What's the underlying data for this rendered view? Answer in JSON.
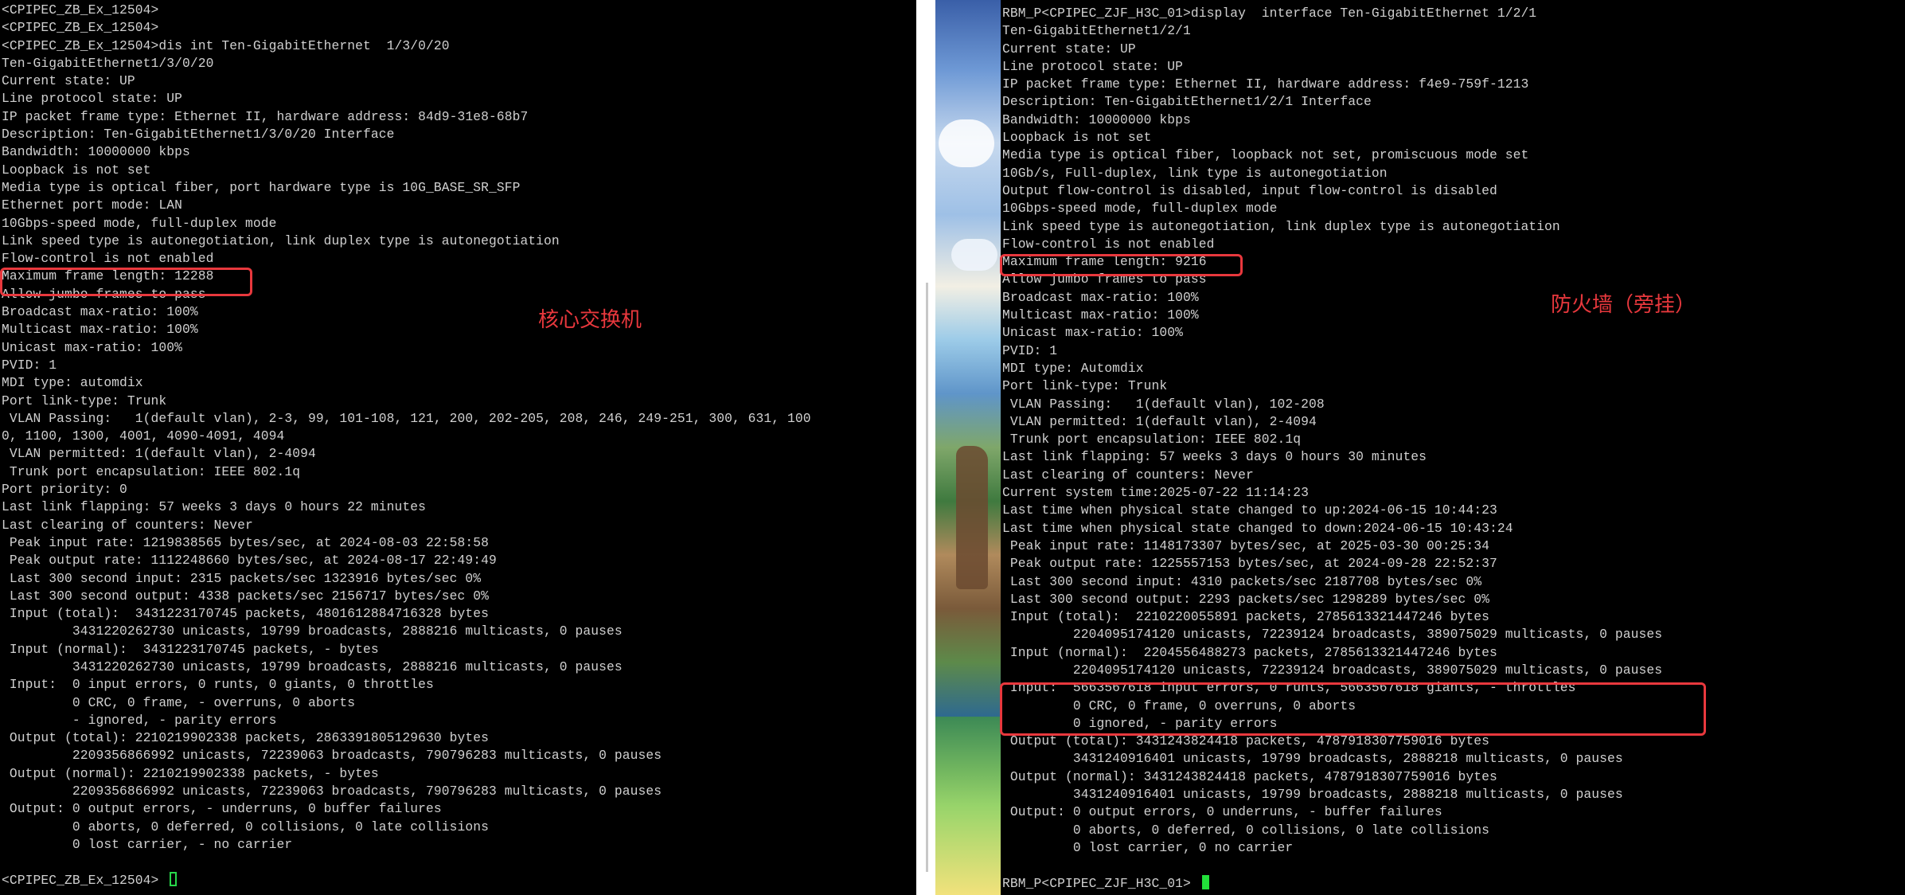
{
  "left_terminal": {
    "lines": [
      "<CPIPEC_ZB_Ex_12504>",
      "<CPIPEC_ZB_Ex_12504>",
      "<CPIPEC_ZB_Ex_12504>dis int Ten-GigabitEthernet  1/3/0/20",
      "Ten-GigabitEthernet1/3/0/20",
      "Current state: UP",
      "Line protocol state: UP",
      "IP packet frame type: Ethernet II, hardware address: 84d9-31e8-68b7",
      "Description: Ten-GigabitEthernet1/3/0/20 Interface",
      "Bandwidth: 10000000 kbps",
      "Loopback is not set",
      "Media type is optical fiber, port hardware type is 10G_BASE_SR_SFP",
      "Ethernet port mode: LAN",
      "10Gbps-speed mode, full-duplex mode",
      "Link speed type is autonegotiation, link duplex type is autonegotiation",
      "Flow-control is not enabled",
      "Maximum frame length: 12288",
      "Allow jumbo frames to pass",
      "Broadcast max-ratio: 100%",
      "Multicast max-ratio: 100%",
      "Unicast max-ratio: 100%",
      "PVID: 1",
      "MDI type: automdix",
      "Port link-type: Trunk",
      " VLAN Passing:   1(default vlan), 2-3, 99, 101-108, 121, 200, 202-205, 208, 246, 249-251, 300, 631, 100",
      "0, 1100, 1300, 4001, 4090-4091, 4094",
      " VLAN permitted: 1(default vlan), 2-4094",
      " Trunk port encapsulation: IEEE 802.1q",
      "Port priority: 0",
      "Last link flapping: 57 weeks 3 days 0 hours 22 minutes",
      "Last clearing of counters: Never",
      " Peak input rate: 1219838565 bytes/sec, at 2024-08-03 22:58:58",
      " Peak output rate: 1112248660 bytes/sec, at 2024-08-17 22:49:49",
      " Last 300 second input: 2315 packets/sec 1323916 bytes/sec 0%",
      " Last 300 second output: 4338 packets/sec 2156717 bytes/sec 0%",
      " Input (total):  3431223170745 packets, 4801612884716328 bytes",
      "         3431220262730 unicasts, 19799 broadcasts, 2888216 multicasts, 0 pauses",
      " Input (normal):  3431223170745 packets, - bytes",
      "         3431220262730 unicasts, 19799 broadcasts, 2888216 multicasts, 0 pauses",
      " Input:  0 input errors, 0 runts, 0 giants, 0 throttles",
      "         0 CRC, 0 frame, - overruns, 0 aborts",
      "         - ignored, - parity errors",
      " Output (total): 2210219902338 packets, 2863391805129630 bytes",
      "         2209356866992 unicasts, 72239063 broadcasts, 790796283 multicasts, 0 pauses",
      " Output (normal): 2210219902338 packets, - bytes",
      "         2209356866992 unicasts, 72239063 broadcasts, 790796283 multicasts, 0 pauses",
      " Output: 0 output errors, - underruns, 0 buffer failures",
      "         0 aborts, 0 deferred, 0 collisions, 0 late collisions",
      "         0 lost carrier, - no carrier",
      "",
      "<CPIPEC_ZB_Ex_12504> "
    ],
    "annotation_label": "核心交换机"
  },
  "right_terminal": {
    "lines": [
      "RBM_P<CPIPEC_ZJF_H3C_01>display  interface Ten-GigabitEthernet 1/2/1",
      "Ten-GigabitEthernet1/2/1",
      "Current state: UP",
      "Line protocol state: UP",
      "IP packet frame type: Ethernet II, hardware address: f4e9-759f-1213",
      "Description: Ten-GigabitEthernet1/2/1 Interface",
      "Bandwidth: 10000000 kbps",
      "Loopback is not set",
      "Media type is optical fiber, loopback not set, promiscuous mode set",
      "10Gb/s, Full-duplex, link type is autonegotiation",
      "Output flow-control is disabled, input flow-control is disabled",
      "10Gbps-speed mode, full-duplex mode",
      "Link speed type is autonegotiation, link duplex type is autonegotiation",
      "Flow-control is not enabled",
      "Maximum frame length: 9216",
      "Allow jumbo frames to pass",
      "Broadcast max-ratio: 100%",
      "Multicast max-ratio: 100%",
      "Unicast max-ratio: 100%",
      "PVID: 1",
      "MDI type: Automdix",
      "Port link-type: Trunk",
      " VLAN Passing:   1(default vlan), 102-208",
      " VLAN permitted: 1(default vlan), 2-4094",
      " Trunk port encapsulation: IEEE 802.1q",
      "Last link flapping: 57 weeks 3 days 0 hours 30 minutes",
      "Last clearing of counters: Never",
      "Current system time:2025-07-22 11:14:23",
      "Last time when physical state changed to up:2024-06-15 10:44:23",
      "Last time when physical state changed to down:2024-06-15 10:43:24",
      " Peak input rate: 1148173307 bytes/sec, at 2025-03-30 00:25:34",
      " Peak output rate: 1225557153 bytes/sec, at 2024-09-28 22:52:37",
      " Last 300 second input: 4310 packets/sec 2187708 bytes/sec 0%",
      " Last 300 second output: 2293 packets/sec 1298289 bytes/sec 0%",
      " Input (total):  2210220055891 packets, 2785613321447246 bytes",
      "         2204095174120 unicasts, 72239124 broadcasts, 389075029 multicasts, 0 pauses",
      " Input (normal):  2204556488273 packets, 2785613321447246 bytes",
      "         2204095174120 unicasts, 72239124 broadcasts, 389075029 multicasts, 0 pauses",
      " Input:  5663567618 input errors, 0 runts, 5663567618 giants, - throttles",
      "         0 CRC, 0 frame, 0 overruns, 0 aborts",
      "         0 ignored, - parity errors",
      " Output (total): 3431243824418 packets, 4787918307759016 bytes",
      "         3431240916401 unicasts, 19799 broadcasts, 2888218 multicasts, 0 pauses",
      " Output (normal): 3431243824418 packets, 4787918307759016 bytes",
      "         3431240916401 unicasts, 19799 broadcasts, 2888218 multicasts, 0 pauses",
      " Output: 0 output errors, 0 underruns, - buffer failures",
      "         0 aborts, 0 deferred, 0 collisions, 0 late collisions",
      "         0 lost carrier, 0 no carrier",
      "",
      "RBM_P<CPIPEC_ZJF_H3C_01> "
    ],
    "annotation_label": "防火墙（旁挂）"
  },
  "colors": {
    "terminal_bg": "#000000",
    "terminal_text": "#d0d0d0",
    "annotation_red": "#e8383d",
    "cursor_green": "#22e03a"
  }
}
